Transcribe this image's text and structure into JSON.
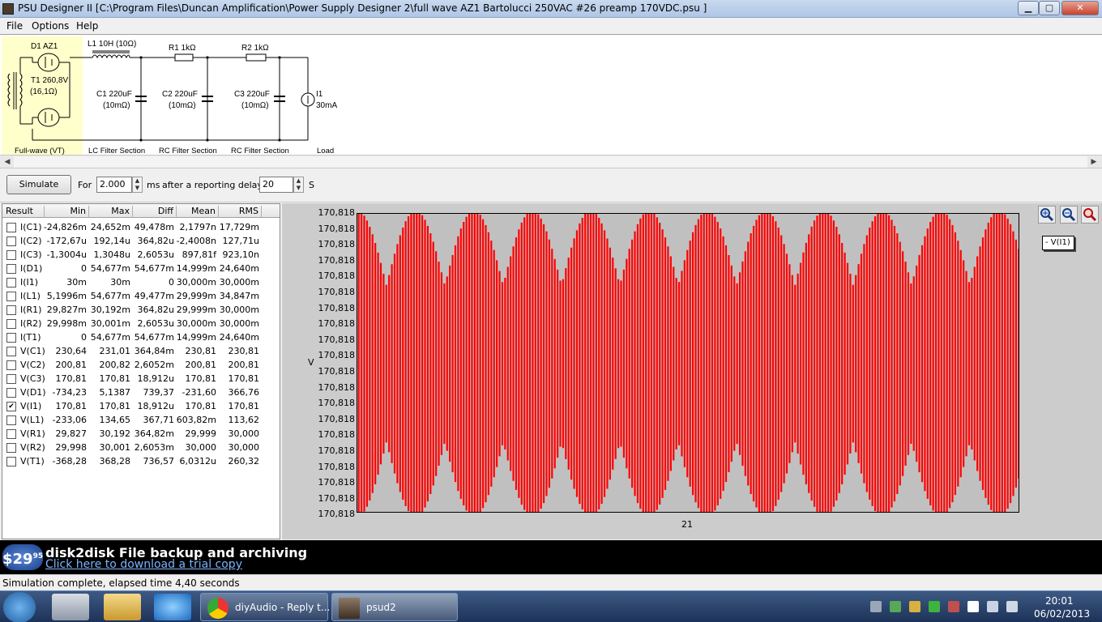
{
  "window": {
    "title": "PSU Designer II  [C:\\Program Files\\Duncan Amplification\\Power Supply Designer 2\\full wave AZ1 Bartolucci 250VAC #26 preamp 170VDC.psu ]",
    "min_label": "▁",
    "max_label": "▢",
    "close_label": "✕"
  },
  "menu": {
    "file": "File",
    "options": "Options",
    "help": "Help"
  },
  "schematic": {
    "d1": "D1 AZ1",
    "t1_line1": "T1 260,8V",
    "t1_line2": "(16,1Ω)",
    "rect_section": "Full-wave (VT)",
    "l1": "L1 10H (10Ω)",
    "c1_line1": "C1 220uF",
    "c1_line2": "(10mΩ)",
    "r1": "R1 1kΩ",
    "c2_line1": "C2 220uF",
    "c2_line2": "(10mΩ)",
    "r2": "R2 1kΩ",
    "c3_line1": "C3 220uF",
    "c3_line2": "(10mΩ)",
    "i1_line1": "I1",
    "i1_line2": "30mA",
    "sec_lc": "LC Filter Section",
    "sec_rc1": "RC Filter Section",
    "sec_rc2": "RC Filter Section",
    "sec_load": "Load"
  },
  "controls": {
    "simulate": "Simulate",
    "for_label": "For",
    "duration": "2.000",
    "ms_label": "ms",
    "after_label": "after a reporting delay of",
    "delay": "20",
    "s_label": "S",
    "spin_up": "▲",
    "spin_down": "▼"
  },
  "table": {
    "headers": [
      "Result",
      "Min",
      "Max",
      "Diff",
      "Mean",
      "RMS"
    ],
    "rows": [
      {
        "name": "I(C1)",
        "checked": false,
        "min": "-24,826m",
        "max": "24,652m",
        "diff": "49,478m",
        "mean": "2,1797n",
        "rms": "17,729m"
      },
      {
        "name": "I(C2)",
        "checked": false,
        "min": "-172,67u",
        "max": "192,14u",
        "diff": "364,82u",
        "mean": "-2,4008n",
        "rms": "127,71u"
      },
      {
        "name": "I(C3)",
        "checked": false,
        "min": "-1,3004u",
        "max": "1,3048u",
        "diff": "2,6053u",
        "mean": "897,81f",
        "rms": "923,10n"
      },
      {
        "name": "I(D1)",
        "checked": false,
        "min": "0",
        "max": "54,677m",
        "diff": "54,677m",
        "mean": "14,999m",
        "rms": "24,640m"
      },
      {
        "name": "I(I1)",
        "checked": false,
        "min": "30m",
        "max": "30m",
        "diff": "0",
        "mean": "30,000m",
        "rms": "30,000m"
      },
      {
        "name": "I(L1)",
        "checked": false,
        "min": "5,1996m",
        "max": "54,677m",
        "diff": "49,477m",
        "mean": "29,999m",
        "rms": "34,847m"
      },
      {
        "name": "I(R1)",
        "checked": false,
        "min": "29,827m",
        "max": "30,192m",
        "diff": "364,82u",
        "mean": "29,999m",
        "rms": "30,000m"
      },
      {
        "name": "I(R2)",
        "checked": false,
        "min": "29,998m",
        "max": "30,001m",
        "diff": "2,6053u",
        "mean": "30,000m",
        "rms": "30,000m"
      },
      {
        "name": "I(T1)",
        "checked": false,
        "min": "0",
        "max": "54,677m",
        "diff": "54,677m",
        "mean": "14,999m",
        "rms": "24,640m"
      },
      {
        "name": "V(C1)",
        "checked": false,
        "min": "230,64",
        "max": "231,01",
        "diff": "364,84m",
        "mean": "230,81",
        "rms": "230,81"
      },
      {
        "name": "V(C2)",
        "checked": false,
        "min": "200,81",
        "max": "200,82",
        "diff": "2,6052m",
        "mean": "200,81",
        "rms": "200,81"
      },
      {
        "name": "V(C3)",
        "checked": false,
        "min": "170,81",
        "max": "170,81",
        "diff": "18,912u",
        "mean": "170,81",
        "rms": "170,81"
      },
      {
        "name": "V(D1)",
        "checked": false,
        "min": "-734,23",
        "max": "5,1387",
        "diff": "739,37",
        "mean": "-231,60",
        "rms": "366,76"
      },
      {
        "name": "V(I1)",
        "checked": true,
        "min": "170,81",
        "max": "170,81",
        "diff": "18,912u",
        "mean": "170,81",
        "rms": "170,81"
      },
      {
        "name": "V(L1)",
        "checked": false,
        "min": "-233,06",
        "max": "134,65",
        "diff": "367,71",
        "mean": "603,82m",
        "rms": "113,62"
      },
      {
        "name": "V(R1)",
        "checked": false,
        "min": "29,827",
        "max": "30,192",
        "diff": "364,82m",
        "mean": "29,999",
        "rms": "30,000"
      },
      {
        "name": "V(R2)",
        "checked": false,
        "min": "29,998",
        "max": "30,001",
        "diff": "2,6053m",
        "mean": "30,000",
        "rms": "30,000"
      },
      {
        "name": "V(T1)",
        "checked": false,
        "min": "-368,28",
        "max": "368,28",
        "diff": "736,57",
        "mean": "6,0312u",
        "rms": "260,32"
      }
    ]
  },
  "chart_data": {
    "type": "line",
    "title": "",
    "xlabel": "21",
    "ylabel": "V",
    "y_tick_labels": [
      "170,818",
      "170,818",
      "170,818",
      "170,818",
      "170,818",
      "170,818",
      "170,818",
      "170,818",
      "170,818",
      "170,818",
      "170,818",
      "170,818",
      "170,818",
      "170,818",
      "170,818",
      "170,818",
      "170,818",
      "170,818",
      "170,818",
      "170,818"
    ],
    "series": [
      {
        "name": "- V(I1)",
        "color": "#ff0000"
      }
    ],
    "background": "#c0c0c0",
    "legend_position": "right"
  },
  "graph": {
    "zoom_in_icon": "zoom-in-icon",
    "zoom_out_icon": "zoom-out-icon",
    "zoom_reset_icon": "zoom-reset-icon"
  },
  "ad": {
    "price": "$29",
    "price_cents": "95",
    "headline": "disk2disk File backup and archiving",
    "link": "Click here to download a trial copy"
  },
  "status": {
    "text": "Simulation complete, elapsed time 4,40 seconds"
  },
  "taskbar": {
    "task1": "diyAudio - Reply t...",
    "task2": "psud2",
    "time": "20:01",
    "date": "06/02/2013"
  },
  "colors": {
    "trace": "#ff0000",
    "plot_bg": "#c0c0c0",
    "schematic_rectifier": "#ffffcc",
    "taskbar": "#1d3258"
  }
}
